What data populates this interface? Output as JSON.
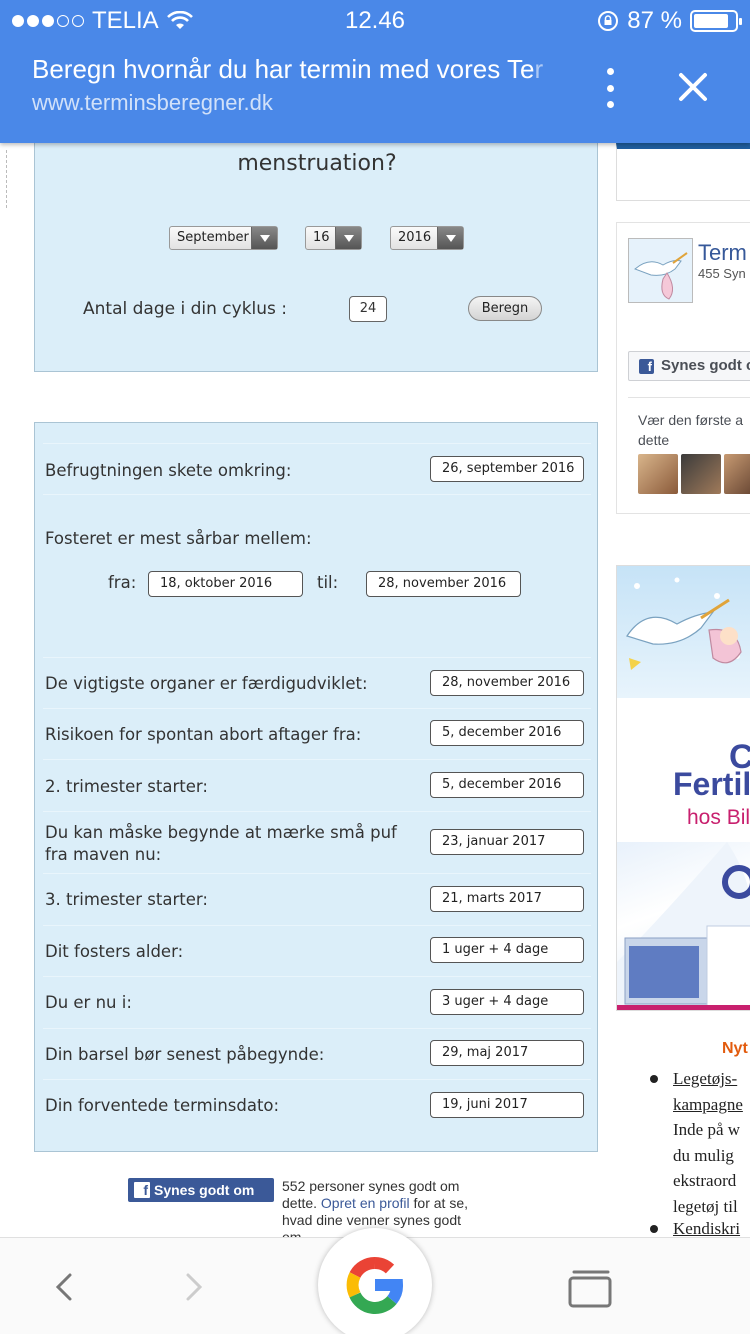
{
  "status_bar": {
    "carrier": "TELIA",
    "time": "12.46",
    "battery": "87 %"
  },
  "chrome_bar": {
    "title": "Beregn hvornår du har termin med vores Te",
    "title_fade": "r",
    "url": "www.terminsberegner.dk"
  },
  "form": {
    "question_partial": "menstruation?",
    "month": "September",
    "day": "16",
    "year": "2016",
    "cycle_label": "Antal dage i din cyklus :",
    "cycle_value": "24",
    "submit_label": "Beregn"
  },
  "results": {
    "conception_label": "Befrugtningen skete omkring:",
    "conception_value": "26,  september  2016",
    "vulnerable_label": "Fosteret er mest sårbar mellem:",
    "from_label": "fra:",
    "from_value": "18,  oktober  2016",
    "to_label": "til:",
    "to_value": "28,  november  2016",
    "rows": [
      {
        "label": "De vigtigste organer er færdigudviklet:",
        "value": "28,  november  2016"
      },
      {
        "label": "Risikoen for spontan abort aftager fra:",
        "value": "5,  december  2016"
      },
      {
        "label": "2. trimester starter:",
        "value": "5,  december  2016"
      },
      {
        "label": "Du kan måske begynde at mærke små puf",
        "label2": "fra maven nu:",
        "value": "23,  januar  2017"
      },
      {
        "label": "3. trimester starter:",
        "value": "21,  marts  2017"
      },
      {
        "label": "Dit fosters alder:",
        "value": "1 uger + 4 dage"
      },
      {
        "label": "Du er nu i:",
        "value": "3 uger + 4 dage"
      },
      {
        "label": "Din barsel bør senest påbegynde:",
        "value": "29,  maj  2017"
      },
      {
        "label": "Din forventede terminsdato:",
        "value": "19,  juni  2017"
      }
    ]
  },
  "fb_like": {
    "button_label": "Synes godt om",
    "text_line1": "552 personer synes godt om",
    "text_line2_pre": "dette. ",
    "text_link": "Opret en profil",
    "text_line2_post": " for at se,",
    "text_line3": "hvad dine venner synes godt",
    "text_line4": "om."
  },
  "sidebar": {
    "page_name": "Term",
    "page_likes": "455 Syn",
    "like_button": "Synes godt c",
    "first_text_line1": "Vær den første a",
    "first_text_line2": "dette",
    "ad_c": "C",
    "ad_fertil": "Fertil",
    "ad_hos": "hos Bill",
    "nyt": "Nyt",
    "news": [
      {
        "line1": "Legetøjs-",
        "line2": "kampagne",
        "rest": [
          "Inde på w",
          "du mulig",
          "ekstraord",
          "legetøj til"
        ]
      },
      {
        "line1": "Kendiskri"
      }
    ]
  },
  "colors": {
    "chrome_blue": "#4a88e8",
    "panel_bg": "#dbeef9",
    "fb_blue": "#3b5998",
    "accent_orange": "#e25b0e"
  }
}
